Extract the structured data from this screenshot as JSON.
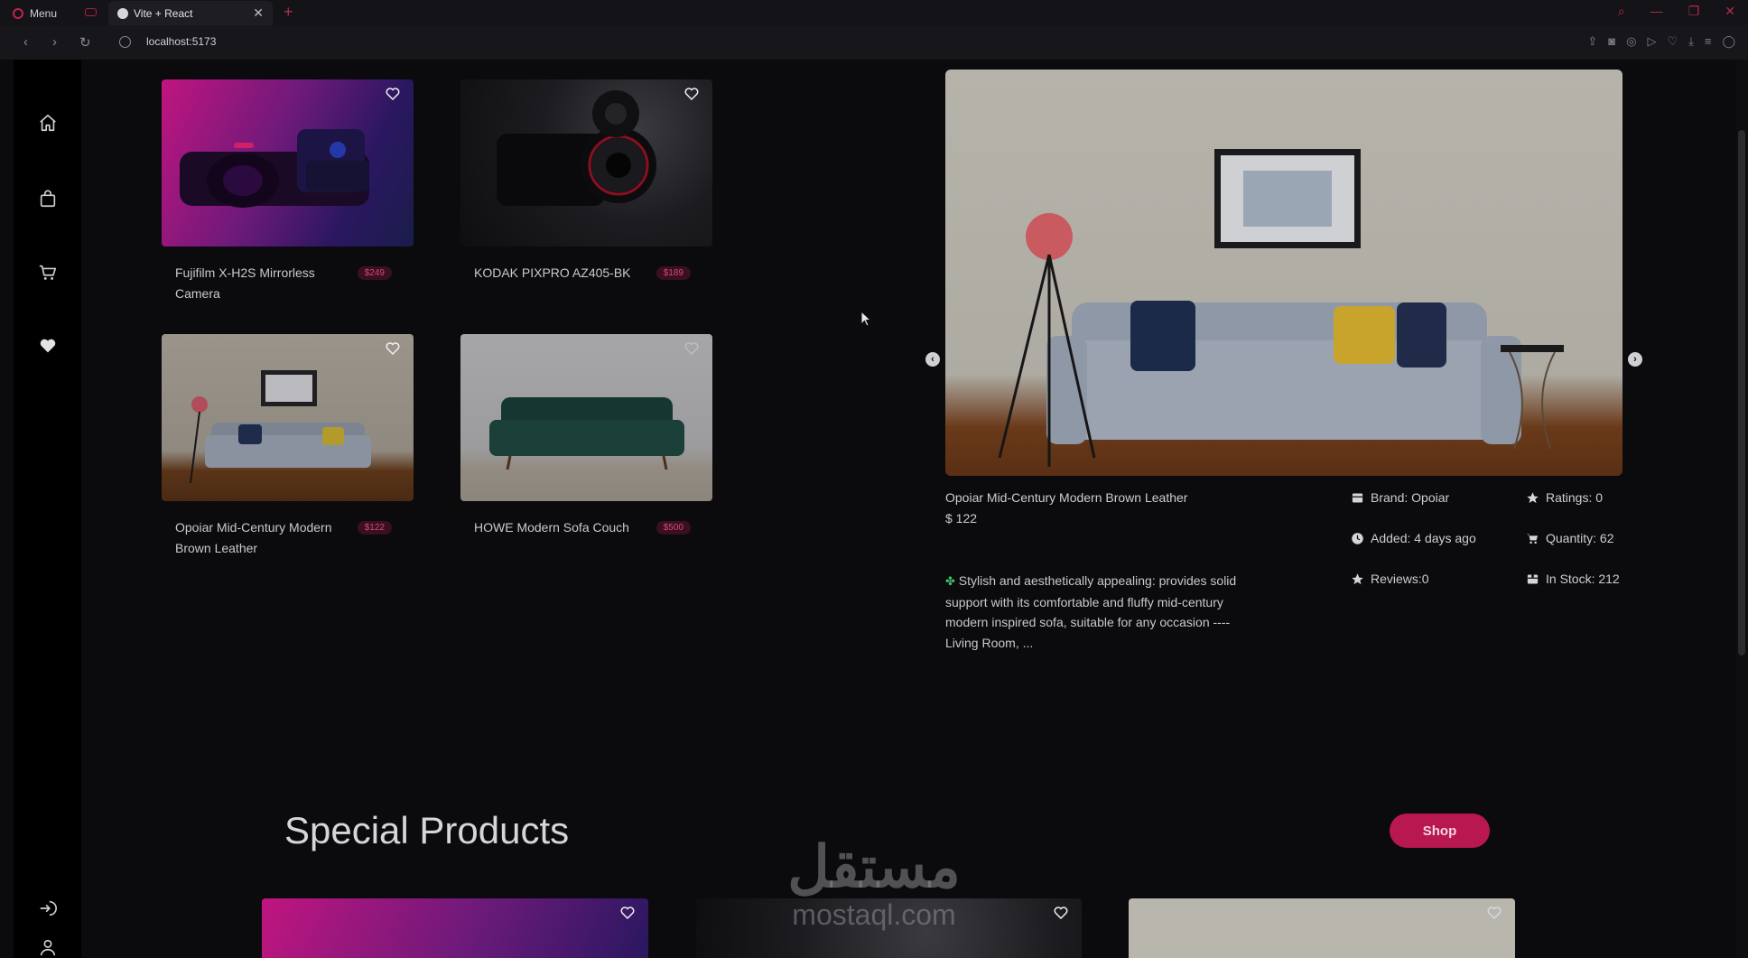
{
  "browser": {
    "menu_label": "Menu",
    "tab_title": "Vite + React",
    "tab_close": "✕",
    "new_tab": "+",
    "url": "localhost:5173"
  },
  "sidebar": {
    "items": [
      {
        "name": "home-icon"
      },
      {
        "name": "bag-icon"
      },
      {
        "name": "cart-icon"
      },
      {
        "name": "heart-icon"
      },
      {
        "name": "logout-icon"
      },
      {
        "name": "user-icon"
      }
    ]
  },
  "products": [
    {
      "title": "Fujifilm X-H2S Mirrorless Camera",
      "price": "$249"
    },
    {
      "title": "KODAK PIXPRO AZ405-BK",
      "price": "$189"
    },
    {
      "title": "Opoiar Mid-Century Modern Brown Leather",
      "price": "$122"
    },
    {
      "title": "HOWE Modern Sofa Couch",
      "price": "$500"
    }
  ],
  "detail": {
    "title": "Opoiar Mid-Century Modern Brown Leather",
    "price": "$ 122",
    "description": "Stylish and aesthetically appealing: provides solid support with its comfortable and fluffy mid-century modern inspired sofa, suitable for any occasion ---- Living Room, ...",
    "brand": "Brand: Opoiar",
    "ratings": "Ratings: 0",
    "added": "Added: 4 days ago",
    "quantity": "Quantity: 62",
    "reviews": "Reviews:0",
    "in_stock": "In Stock: 212"
  },
  "special": {
    "title": "Special Products",
    "shop_label": "Shop"
  },
  "watermark": {
    "arabic": "مستقل",
    "latin": "mostaql.com"
  },
  "colors": {
    "accent": "#b8184f",
    "background": "#0b0b0d",
    "sidebar": "#000000"
  }
}
